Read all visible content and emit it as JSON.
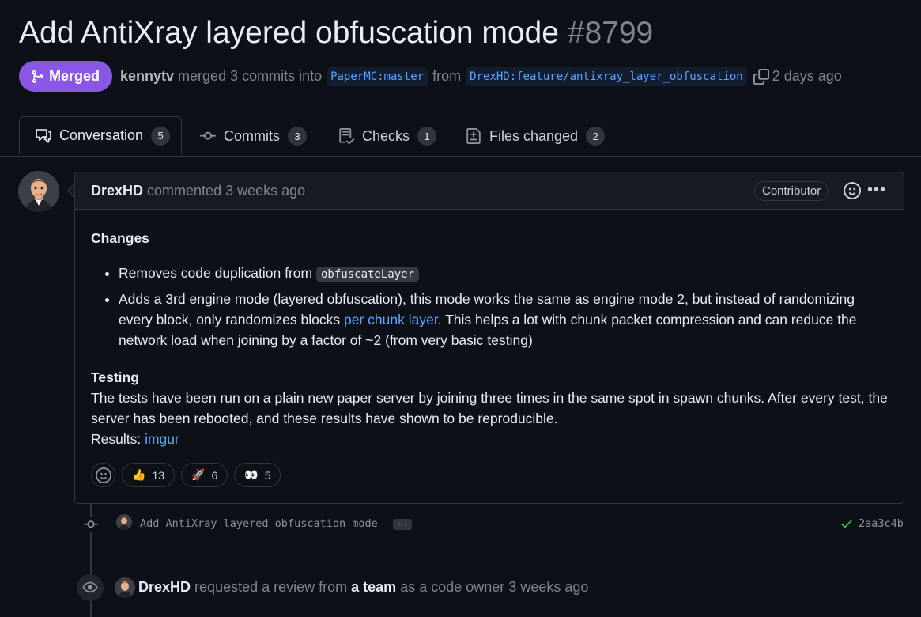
{
  "pr": {
    "title": "Add AntiXray layered obfuscation mode",
    "number": "#8799",
    "status": "Merged",
    "merger": "kennytv",
    "merge_text": "merged 3 commits into",
    "base_branch": "PaperMC:master",
    "from_text": "from",
    "head_branch": "DrexHD:feature/antixray_layer_obfuscation",
    "time_ago": "2 days ago"
  },
  "tabs": [
    {
      "label": "Conversation",
      "count": "5",
      "icon": "comment-discussion-icon"
    },
    {
      "label": "Commits",
      "count": "3",
      "icon": "git-commit-icon"
    },
    {
      "label": "Checks",
      "count": "1",
      "icon": "checklist-icon"
    },
    {
      "label": "Files changed",
      "count": "2",
      "icon": "file-diff-icon"
    }
  ],
  "comment": {
    "author": "DrexHD",
    "action": "commented 3 weeks ago",
    "badge": "Contributor",
    "changes_heading": "Changes",
    "bullet1_text": "Removes code duplication from",
    "bullet1_code": "obfuscateLayer",
    "bullet2_before": "Adds a 3rd engine mode (layered obfuscation), this mode works the same as engine mode 2, but instead of randomizing every block, only randomizes blocks",
    "bullet2_link": "per chunk layer",
    "bullet2_after": ". This helps a lot with chunk packet compression and can reduce the network load when joining by a factor of ~2 (from very basic testing)",
    "testing_heading": "Testing",
    "testing_text": "The tests have been run on a plain new paper server by joining three times in the same spot in spawn chunks. After every test, the server has been rebooted, and these results have shown to be reproducible.",
    "results_label": "Results:",
    "results_link": "imgur",
    "reactions": [
      {
        "emoji": "👍",
        "count": "13"
      },
      {
        "emoji": "🚀",
        "count": "6"
      },
      {
        "emoji": "👀",
        "count": "5"
      }
    ]
  },
  "commit": {
    "message": "Add AntiXray layered obfuscation mode",
    "ellipsis": "···",
    "sha": "2aa3c4b"
  },
  "review_event": {
    "actor": "DrexHD",
    "text1": "requested a review from",
    "team": "a team",
    "text2": "as a code owner 3 weeks ago"
  },
  "colors": {
    "merged_purple": "#8957e5",
    "link_blue": "#58a6ff",
    "success_green": "#3fb950",
    "background": "#0d1117"
  }
}
